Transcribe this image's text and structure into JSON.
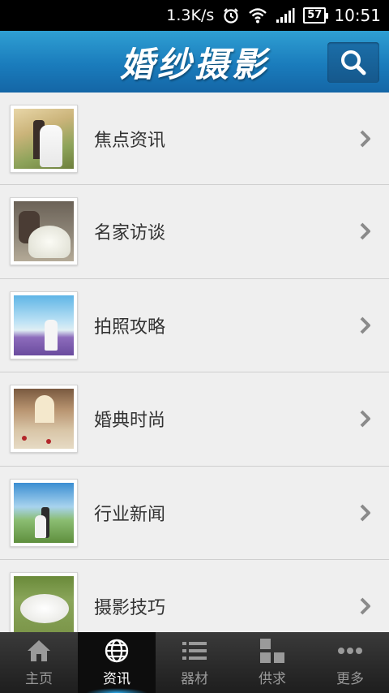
{
  "status_bar": {
    "speed": "1.3K/s",
    "battery": "57",
    "time": "10:51"
  },
  "header": {
    "title": "婚纱摄影"
  },
  "list": {
    "items": [
      {
        "label": "焦点资讯"
      },
      {
        "label": "名家访谈"
      },
      {
        "label": "拍照攻略"
      },
      {
        "label": "婚典时尚"
      },
      {
        "label": "行业新闻"
      },
      {
        "label": "摄影技巧"
      }
    ]
  },
  "bottom_nav": {
    "items": [
      {
        "label": "主页",
        "icon": "home-icon"
      },
      {
        "label": "资讯",
        "icon": "globe-icon",
        "active": true
      },
      {
        "label": "器材",
        "icon": "list-icon"
      },
      {
        "label": "供求",
        "icon": "grid-icon"
      },
      {
        "label": "更多",
        "icon": "more-icon"
      }
    ]
  }
}
